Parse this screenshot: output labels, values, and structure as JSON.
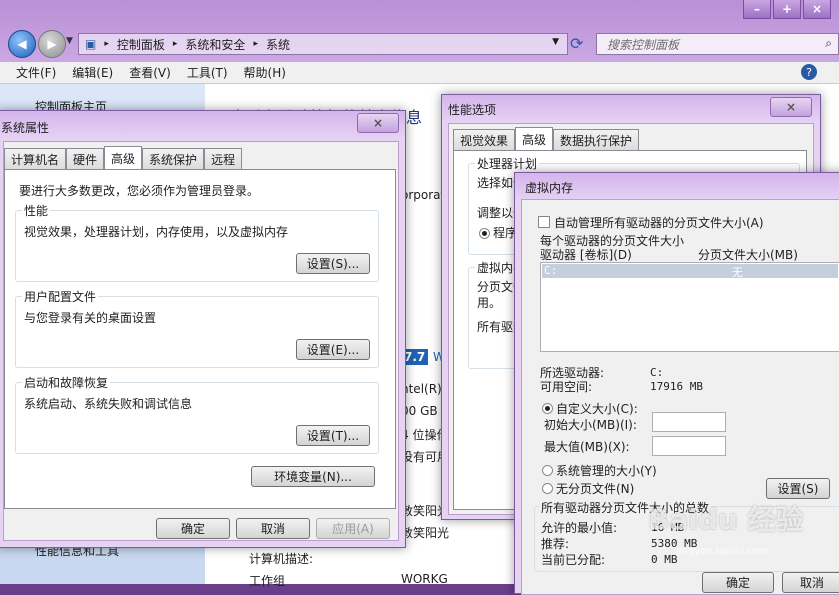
{
  "explorer": {
    "breadcrumb": [
      "控制面板",
      "系统和安全",
      "系统"
    ],
    "search_placeholder": "搜索控制面板",
    "menu": [
      "文件(F)",
      "编辑(E)",
      "查看(V)",
      "工具(T)",
      "帮助(H)"
    ],
    "left_top": "控制面板主页",
    "left_bottom": "性能信息和工具",
    "main_heading": "查看有关计算机的基本信息",
    "frag_corp": "orporat",
    "frag_score": "7.7",
    "frag_w": "W",
    "frag_intel": "ntel(R)",
    "frag_gb": "00 GB",
    "frag_bits": "4 位操作",
    "frag_available": "没有可用",
    "frag_user1": "敦笑阳光",
    "frag_user2": "敦笑阳光",
    "computer_desc": "计算机描述:",
    "workgroup_label": "工作组",
    "workgroup_value": "WORKG"
  },
  "sysprops": {
    "title": "系统属性",
    "tabs": [
      "计算机名",
      "硬件",
      "高级",
      "系统保护",
      "远程"
    ],
    "admin_note": "要进行大多数更改，您必须作为管理员登录。",
    "perf_title": "性能",
    "perf_desc": "视觉效果，处理器计划，内存使用，以及虚拟内存",
    "perf_btn": "设置(S)...",
    "profile_title": "用户配置文件",
    "profile_desc": "与您登录有关的桌面设置",
    "profile_btn": "设置(E)...",
    "startup_title": "启动和故障恢复",
    "startup_desc": "系统启动、系统失败和调试信息",
    "startup_btn": "设置(T)...",
    "env_btn": "环境变量(N)...",
    "ok": "确定",
    "cancel": "取消",
    "apply": "应用(A)"
  },
  "perfopts": {
    "title": "性能选项",
    "tabs": [
      "视觉效果",
      "高级",
      "数据执行保护"
    ],
    "cpu_group": "处理器计划",
    "cpu_desc": "选择如何",
    "adjust": "调整以优",
    "programs": "程序",
    "vm_group": "虚拟内存",
    "vm_desc1": "分页文件",
    "vm_desc2": "用。",
    "all_drives": "所有驱动"
  },
  "vmem": {
    "title": "虚拟内存",
    "auto_manage": "自动管理所有驱动器的分页文件大小(A)",
    "each_drive": "每个驱动器的分页文件大小",
    "col_drive": "驱动器 [卷标](D)",
    "col_size": "分页文件大小(MB)",
    "drive_row_drive": "C:",
    "drive_row_size": "无",
    "selected_drive_label": "所选驱动器:",
    "selected_drive_value": "C:",
    "free_space_label": "可用空间:",
    "free_space_value": "17916 MB",
    "custom_size": "自定义大小(C):",
    "initial_size": "初始大小(MB)(I):",
    "max_size": "最大值(MB)(X):",
    "system_managed": "系统管理的大小(Y)",
    "no_paging": "无分页文件(N)",
    "set_btn": "设置(S)",
    "total_group": "所有驱动器分页文件大小的总数",
    "min_allowed_label": "允许的最小值:",
    "min_allowed_value": "16 MB",
    "recommended_label": "推荐:",
    "recommended_value": "5380 MB",
    "current_label": "当前已分配:",
    "current_value": "0 MB",
    "ok": "确定",
    "cancel": "取消"
  },
  "watermark": {
    "text": "Baidu 经验",
    "url": "jingyan.baidu.com"
  },
  "colors": {
    "aero_accent": "#b98fd6",
    "selection": "#3399ff"
  }
}
